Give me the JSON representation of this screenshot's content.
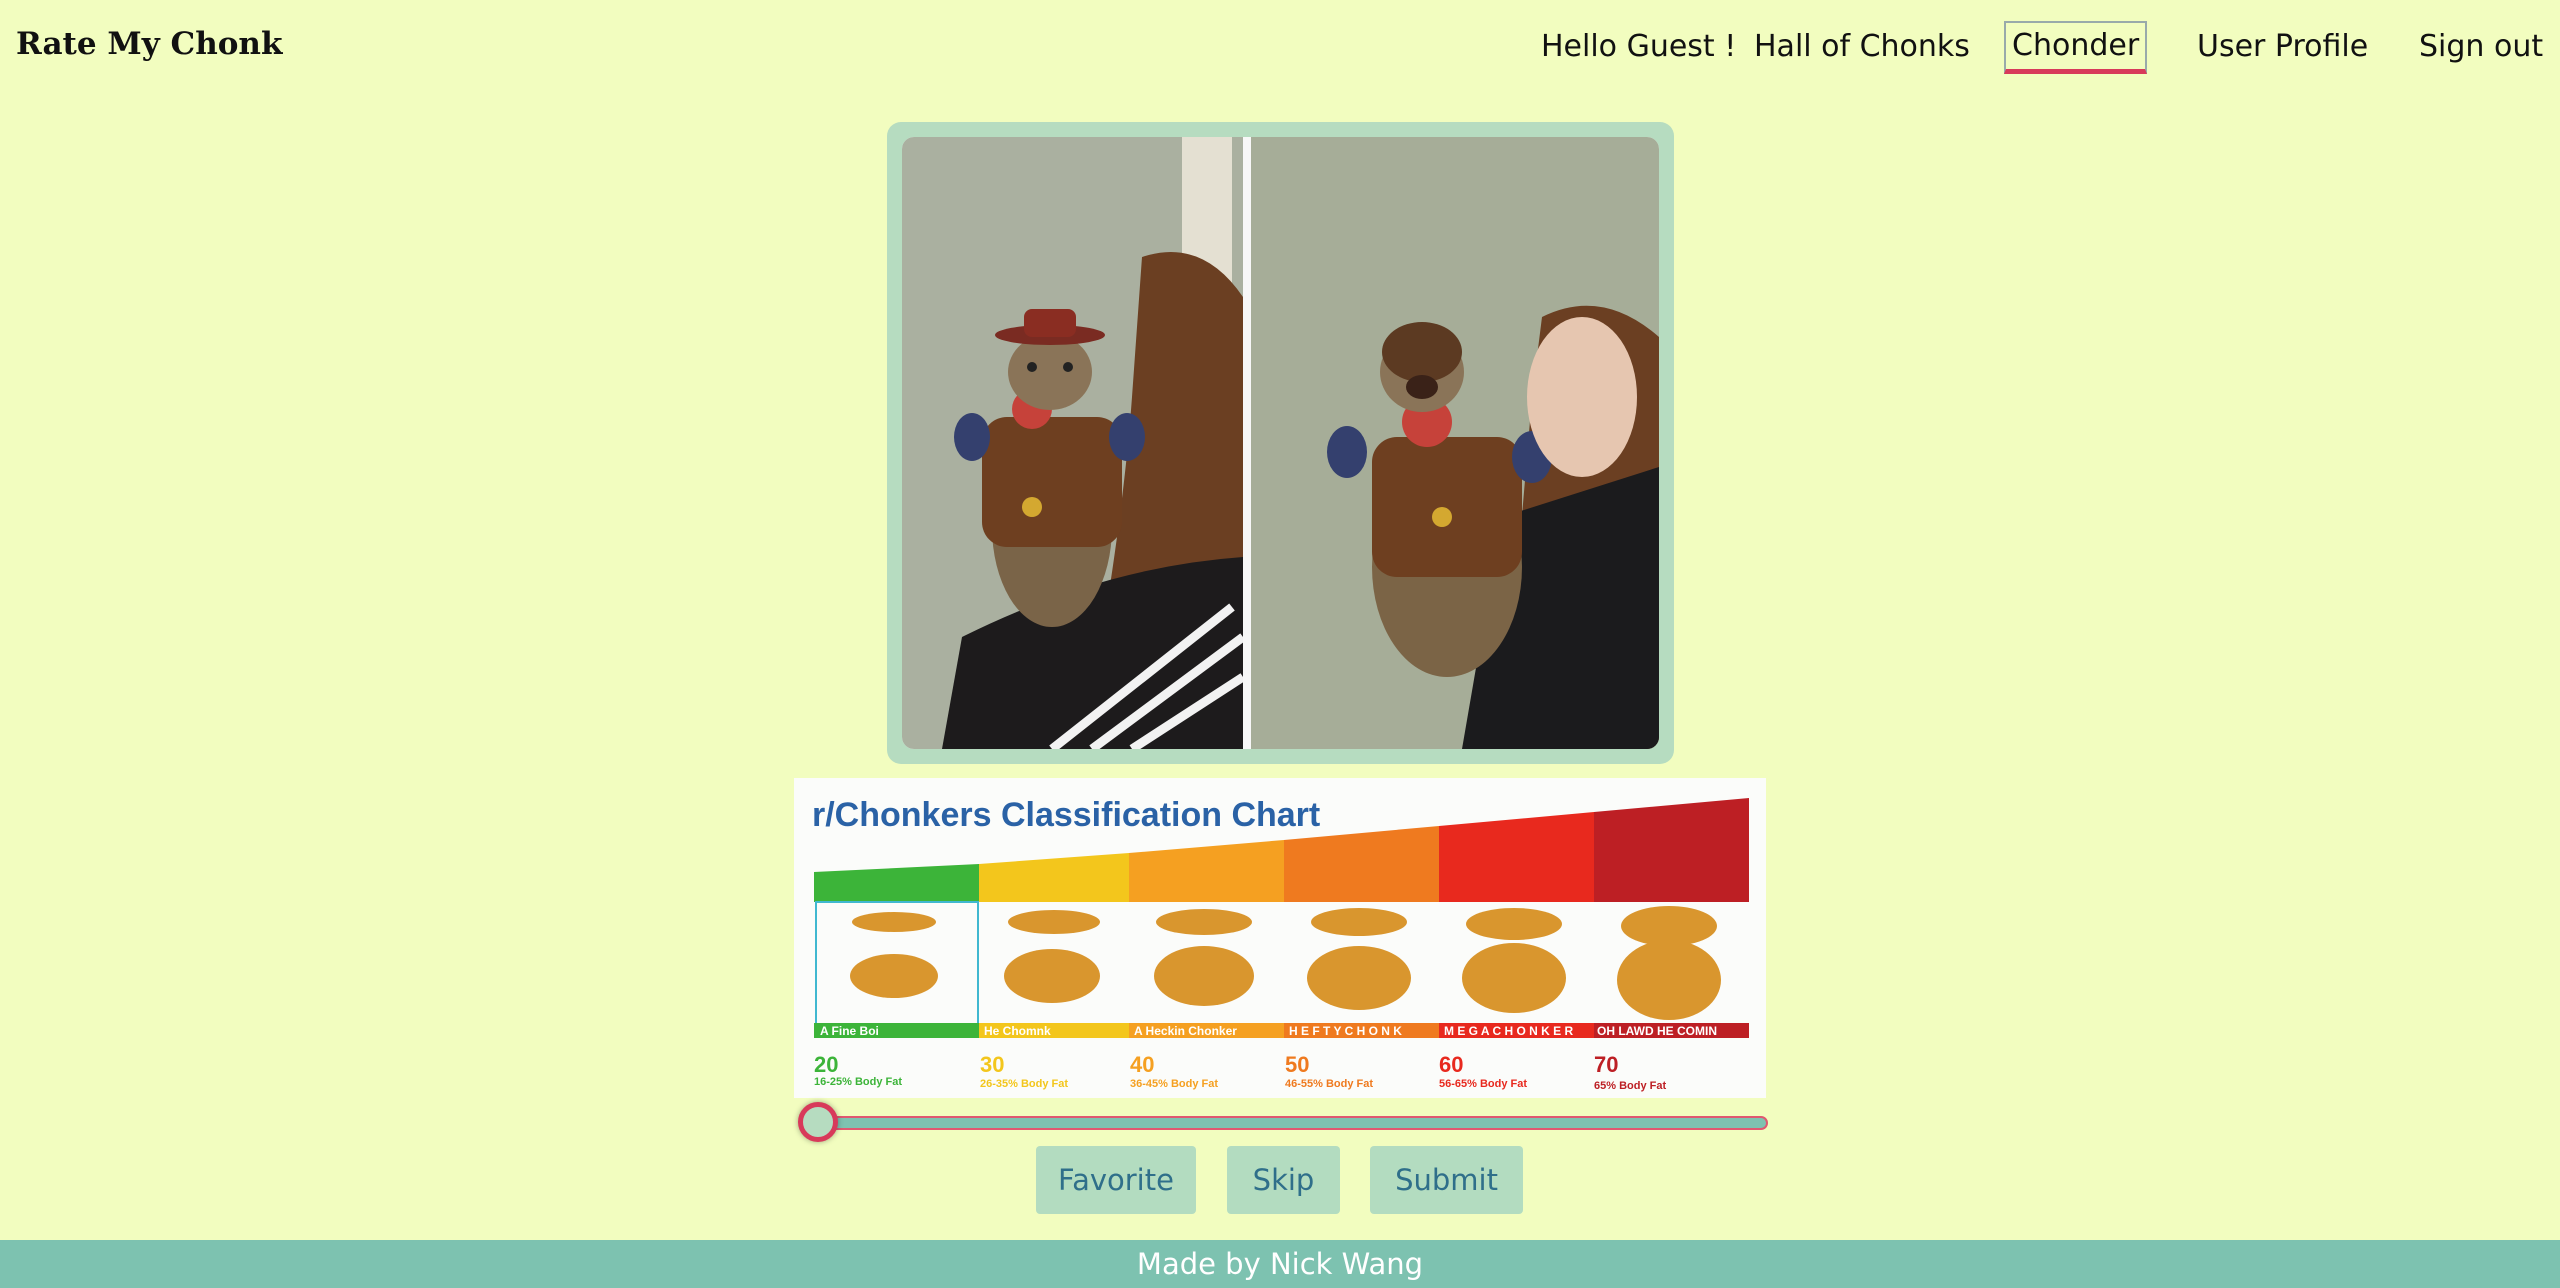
{
  "header": {
    "brand": "Rate My Chonk",
    "nav": [
      {
        "label": "Hello Guest !"
      },
      {
        "label": "Hall of Chonks"
      },
      {
        "label": "Chonder"
      },
      {
        "label": "User Profile"
      },
      {
        "label": "Sign out"
      }
    ]
  },
  "chart": {
    "title": "r/Chonkers Classification Chart",
    "tiers": [
      {
        "name": "A Fine Boi",
        "score": "20",
        "fat": "16-25% Body Fat",
        "color": "#3cb439"
      },
      {
        "name": "He Chomnk",
        "score": "30",
        "fat": "26-35% Body Fat",
        "color": "#f3c61c"
      },
      {
        "name": "A Heckin Chonker",
        "score": "40",
        "fat": "36-45% Body Fat",
        "color": "#f5a021"
      },
      {
        "name": "H E F T Y C H O N K",
        "score": "50",
        "fat": "46-55% Body Fat",
        "color": "#ef7a1f"
      },
      {
        "name": "M E G A C H O N K E R",
        "score": "60",
        "fat": "56-65% Body Fat",
        "color": "#e8291e"
      },
      {
        "name": "OH LAWD HE COMIN",
        "score": "70",
        "fat": "65% Body Fat",
        "color": "#bd1f24"
      }
    ]
  },
  "rating": {
    "value": 20,
    "min": 20,
    "max": 70
  },
  "actions": {
    "favorite": "Favorite",
    "skip": "Skip",
    "submit": "Submit"
  },
  "footer": {
    "text": "Made by Nick Wang"
  },
  "colors": {
    "background": "#f2fdbf",
    "accent": "#d83a5a",
    "teal": "#7dc2b0",
    "button": "#b3dcc0",
    "button_text": "#2f6f8a"
  }
}
